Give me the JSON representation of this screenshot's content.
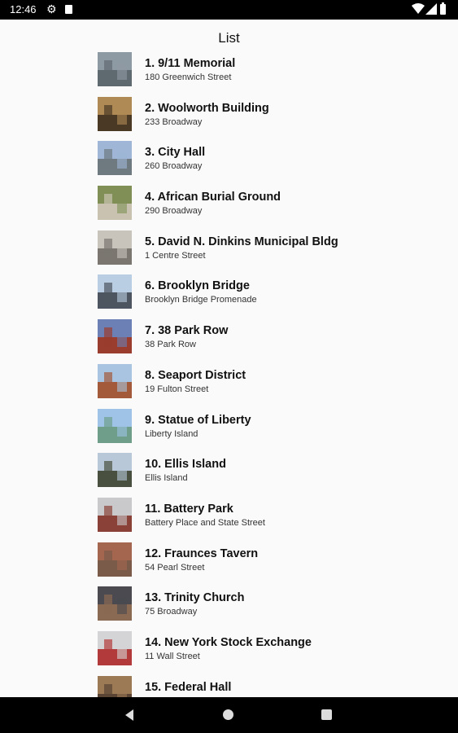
{
  "status_bar": {
    "time": "12:46"
  },
  "header": {
    "title": "List"
  },
  "items": [
    {
      "title": "1. 9/11 Memorial",
      "address": "180 Greenwich Street"
    },
    {
      "title": "2. Woolworth Building",
      "address": "233 Broadway"
    },
    {
      "title": "3. City Hall",
      "address": "260 Broadway"
    },
    {
      "title": "4. African Burial Ground",
      "address": "290 Broadway"
    },
    {
      "title": "5. David N. Dinkins Municipal Bldg",
      "address": "1 Centre Street"
    },
    {
      "title": "6. Brooklyn Bridge",
      "address": "Brooklyn Bridge Promenade"
    },
    {
      "title": "7. 38 Park Row",
      "address": "38 Park Row"
    },
    {
      "title": "8. Seaport District",
      "address": "19 Fulton Street"
    },
    {
      "title": "9. Statue of Liberty",
      "address": "Liberty Island"
    },
    {
      "title": "10. Ellis Island",
      "address": "Ellis Island"
    },
    {
      "title": "11. Battery Park",
      "address": "Battery Place and State Street"
    },
    {
      "title": "12. Fraunces Tavern",
      "address": "54 Pearl Street"
    },
    {
      "title": "13. Trinity Church",
      "address": "75 Broadway"
    },
    {
      "title": "14. New York Stock Exchange",
      "address": "11 Wall Street"
    },
    {
      "title": "15. Federal Hall",
      "address": ""
    }
  ],
  "thumb_colors": [
    [
      "#8e9aa3",
      "#5f6a70"
    ],
    [
      "#b08a55",
      "#4a3a25"
    ],
    [
      "#9fb6d6",
      "#6f7a80"
    ],
    [
      "#7f8f55",
      "#c9c2b0"
    ],
    [
      "#c8c3bb",
      "#7b7770"
    ],
    [
      "#b9cde3",
      "#4d5660"
    ],
    [
      "#6d80b5",
      "#9a3c2e"
    ],
    [
      "#a8c4e0",
      "#a35a3b"
    ],
    [
      "#9ec3e6",
      "#6f9e8a"
    ],
    [
      "#b8c8d8",
      "#4a5040"
    ],
    [
      "#c9c9cc",
      "#8a4238"
    ],
    [
      "#a56650",
      "#7a5a48"
    ],
    [
      "#4a4a50",
      "#8a6a52"
    ],
    [
      "#d4d4d6",
      "#b33a3a"
    ],
    [
      "#9b7a55",
      "#5a4535"
    ]
  ]
}
